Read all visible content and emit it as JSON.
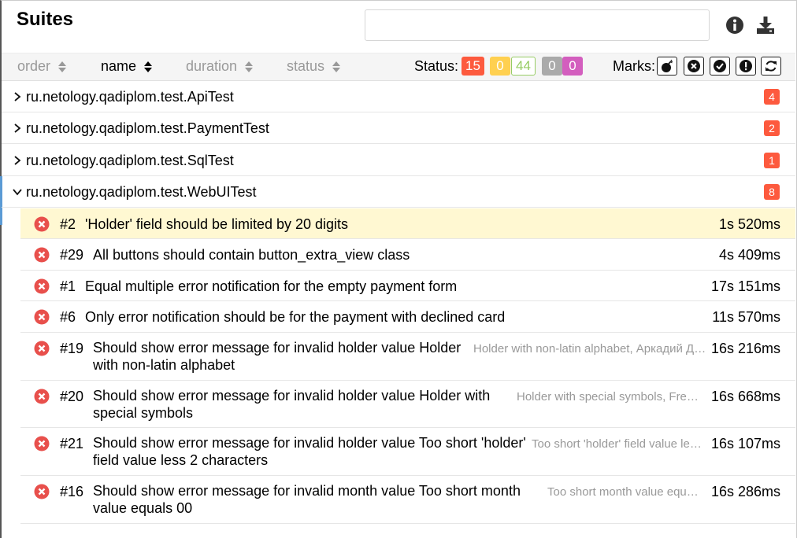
{
  "header": {
    "title": "Suites",
    "search_placeholder": ""
  },
  "sort": {
    "order": "order",
    "name": "name",
    "duration": "duration",
    "status": "status",
    "active": "name"
  },
  "status_filter": {
    "label": "Status:",
    "failed": "15",
    "broken": "0",
    "passed": "44",
    "skipped": "0",
    "unknown": "0",
    "colors": {
      "failed": "#fd5a3e",
      "broken": "#ffd050",
      "passed": "#97cc64",
      "skipped": "#aaaaaa",
      "unknown": "#d35ebe"
    }
  },
  "marks": {
    "label": "Marks:",
    "items": [
      "bomb-icon",
      "close-circle-icon",
      "check-circle-icon",
      "exclamation-circle-icon",
      "refresh-icon"
    ]
  },
  "suites": [
    {
      "name": "ru.netology.qadiplom.test.ApiTest",
      "count": "4",
      "expanded": false
    },
    {
      "name": "ru.netology.qadiplom.test.PaymentTest",
      "count": "2",
      "expanded": false
    },
    {
      "name": "ru.netology.qadiplom.test.SqlTest",
      "count": "1",
      "expanded": false
    },
    {
      "name": "ru.netology.qadiplom.test.WebUITest",
      "count": "8",
      "expanded": true
    }
  ],
  "tests": [
    {
      "num": "#2",
      "name": "'Holder' field should be limited by 20 digits",
      "param": "",
      "duration": "1s 520ms",
      "selected": true
    },
    {
      "num": "#29",
      "name": "All buttons should contain button_extra_view class",
      "param": "",
      "duration": "4s 409ms"
    },
    {
      "num": "#1",
      "name": "Equal multiple error notification for the empty payment form",
      "param": "",
      "duration": "17s 151ms"
    },
    {
      "num": "#6",
      "name": "Only error notification should be for the payment with declined card",
      "param": "",
      "duration": "11s 570ms"
    },
    {
      "num": "#19",
      "name_line1": "Should show error message for invalid holder value Holder",
      "name_line2": "with non-latin alphabet",
      "param": "Holder with non-latin alphabet, Аркадий Де...",
      "duration": "16s 216ms"
    },
    {
      "num": "#20",
      "name_line1": "Should show error message for invalid holder value Holder with",
      "name_line2": "special symbols",
      "param": "Holder with special symbols, Fred...",
      "duration": "16s 668ms"
    },
    {
      "num": "#21",
      "name_line1": "Should show error message for invalid holder value Too short 'holder'",
      "name_line2": "field value less 2 characters",
      "param": "Too short 'holder' field value les...",
      "duration": "16s 107ms"
    },
    {
      "num": "#16",
      "name_line1": "Should show error message for invalid month value Too short month",
      "name_line2": "value equals 00",
      "param": "Too short month value equal...",
      "duration": "16s 286ms"
    }
  ]
}
